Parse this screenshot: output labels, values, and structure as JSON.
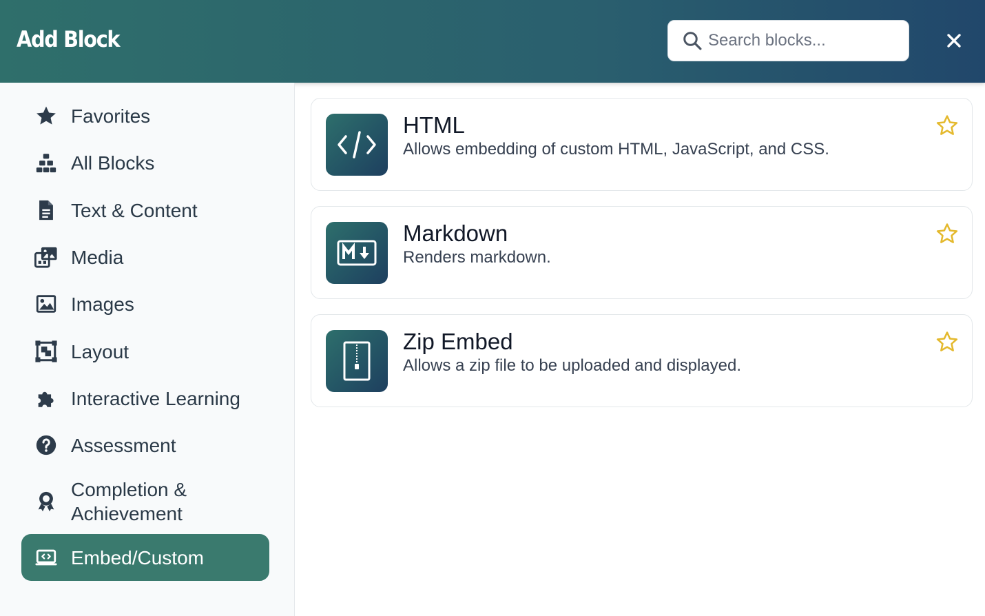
{
  "header": {
    "title": "Add Block",
    "search_placeholder": "Search blocks..."
  },
  "sidebar": {
    "items": [
      {
        "label": "Favorites",
        "icon": "star-icon"
      },
      {
        "label": "All Blocks",
        "icon": "cubes-icon"
      },
      {
        "label": "Text & Content",
        "icon": "file-text-icon"
      },
      {
        "label": "Media",
        "icon": "photo-video-icon"
      },
      {
        "label": "Images",
        "icon": "image-icon"
      },
      {
        "label": "Layout",
        "icon": "layout-icon"
      },
      {
        "label": "Interactive Learning",
        "icon": "puzzle-icon"
      },
      {
        "label": "Assessment",
        "icon": "question-circle-icon"
      },
      {
        "label": "Completion & Achievement",
        "icon": "award-icon"
      },
      {
        "label": "Embed/Custom",
        "icon": "embed-icon",
        "active": true
      }
    ]
  },
  "blocks": [
    {
      "name": "HTML",
      "description": "Allows embedding of custom HTML, JavaScript, and CSS.",
      "icon": "code-icon"
    },
    {
      "name": "Markdown",
      "description": "Renders markdown.",
      "icon": "markdown-icon"
    },
    {
      "name": "Zip Embed",
      "description": "Allows a zip file to be uploaded and displayed.",
      "icon": "zip-file-icon"
    }
  ],
  "colors": {
    "header_start": "#2f6f6b",
    "header_end": "#21476b",
    "active_item": "#3a7a6e",
    "star": "#e4b92d"
  }
}
